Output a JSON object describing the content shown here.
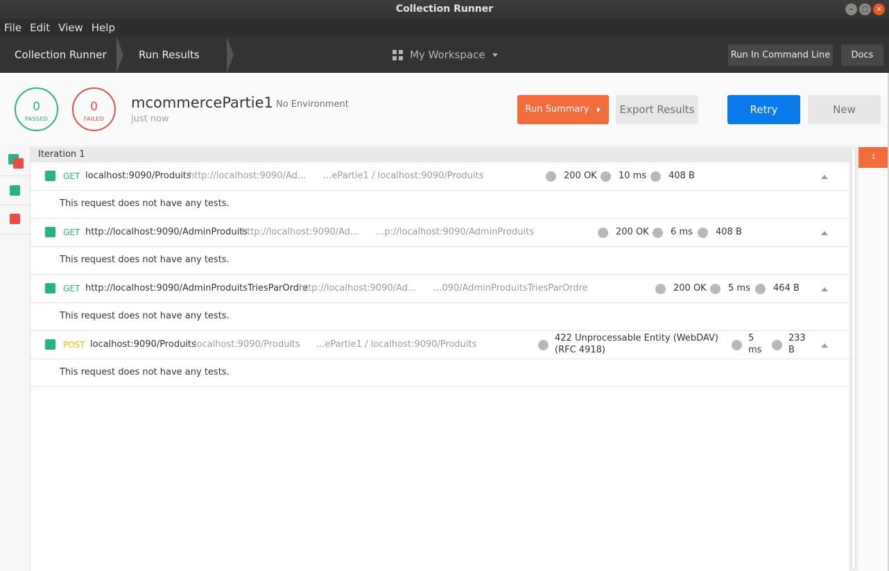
{
  "window": {
    "title": "Collection Runner",
    "controls": [
      "–",
      "□",
      "×"
    ]
  },
  "menu": [
    "File",
    "Edit",
    "View",
    "Help"
  ],
  "header": {
    "crumbs": [
      "Collection Runner",
      "Run Results"
    ],
    "workspace": "My Workspace",
    "run_cli": "Run In Command Line",
    "docs": "Docs"
  },
  "summary": {
    "passed_count": "0",
    "passed_label": "PASSED",
    "failed_count": "0",
    "failed_label": "FAILED",
    "collection": "mcommercePartie1",
    "environment": "No Environment",
    "time": "just now",
    "run_summary": "Run Summary",
    "export": "Export Results",
    "retry": "Retry",
    "new": "New"
  },
  "iteration": {
    "label": "Iteration 1",
    "badge": "1"
  },
  "requests": [
    {
      "method": "GET",
      "name": "localhost:9090/Produits",
      "url": "http://localhost:9090/Ad...",
      "path": "...ePartie1 / localhost:9090/Produits",
      "status": "200 OK",
      "time": "10 ms",
      "size": "408 B",
      "tests": "This request does not have any tests."
    },
    {
      "method": "GET",
      "name": "http://localhost:9090/AdminProduits",
      "url": "http://localhost:9090/Ad...",
      "path": "...p://localhost:9090/AdminProduits",
      "status": "200 OK",
      "time": "6 ms",
      "size": "408 B",
      "tests": "This request does not have any tests."
    },
    {
      "method": "GET",
      "name": "http://localhost:9090/AdminProduitsTriesParOrdre",
      "url": "http://localhost:9090/Ad...",
      "path": "...090/AdminProduitsTriesParOrdre",
      "status": "200 OK",
      "time": "5 ms",
      "size": "464 B",
      "tests": "This request does not have any tests."
    },
    {
      "method": "POST",
      "name": "localhost:9090/Produits",
      "url": "localhost:9090/Produits",
      "path": "...ePartie1 / localhost:9090/Produits",
      "status": "422 Unprocessable Entity (WebDAV) (RFC 4918)",
      "time": "5 ms",
      "size": "233 B",
      "tests": "This request does not have any tests."
    }
  ],
  "colors": {
    "accent_orange": "#f26b3a",
    "retry_blue": "#097bed",
    "pass_green": "#26b47f",
    "fail_red": "#ed4b48",
    "post_yellow": "#ffb400"
  }
}
